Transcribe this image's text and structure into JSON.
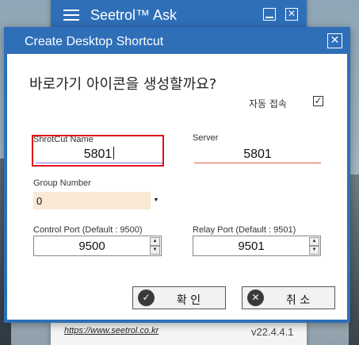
{
  "back_window": {
    "title": "Seetrol™ Ask",
    "minimize_glyph": "",
    "close_glyph": "✕",
    "footer_url": "https://www.seetrol.co.kr",
    "version": "v22.4.4.1"
  },
  "dialog": {
    "title": "Create Desktop Shortcut",
    "close_glyph": "✕",
    "question": "바로가기 아이콘을 생성할까요?",
    "auto_connect": {
      "label": "자동 접속",
      "checked": true,
      "check_glyph": "✓"
    },
    "shortcut_name": {
      "label": "ShrotCut Name",
      "value": "5801"
    },
    "server": {
      "label": "Server",
      "value": "5801"
    },
    "group_number": {
      "label": "Group Number",
      "value": "0",
      "arrow": "▼"
    },
    "control_port": {
      "label": "Control Port (Default : 9500)",
      "value": "9500"
    },
    "relay_port": {
      "label": "Relay Port (Default : 9501)",
      "value": "9501"
    },
    "spin_up": "▲",
    "spin_down": "▼",
    "ok_button": {
      "label": "확 인",
      "icon_glyph": "✓"
    },
    "cancel_button": {
      "label": "취 소",
      "icon_glyph": "✕"
    }
  },
  "colors": {
    "titlebar": "#2e6fb8",
    "highlight_border": "#e0101a",
    "server_underline": "#e05a4a",
    "group_bg": "#fae8d4"
  }
}
